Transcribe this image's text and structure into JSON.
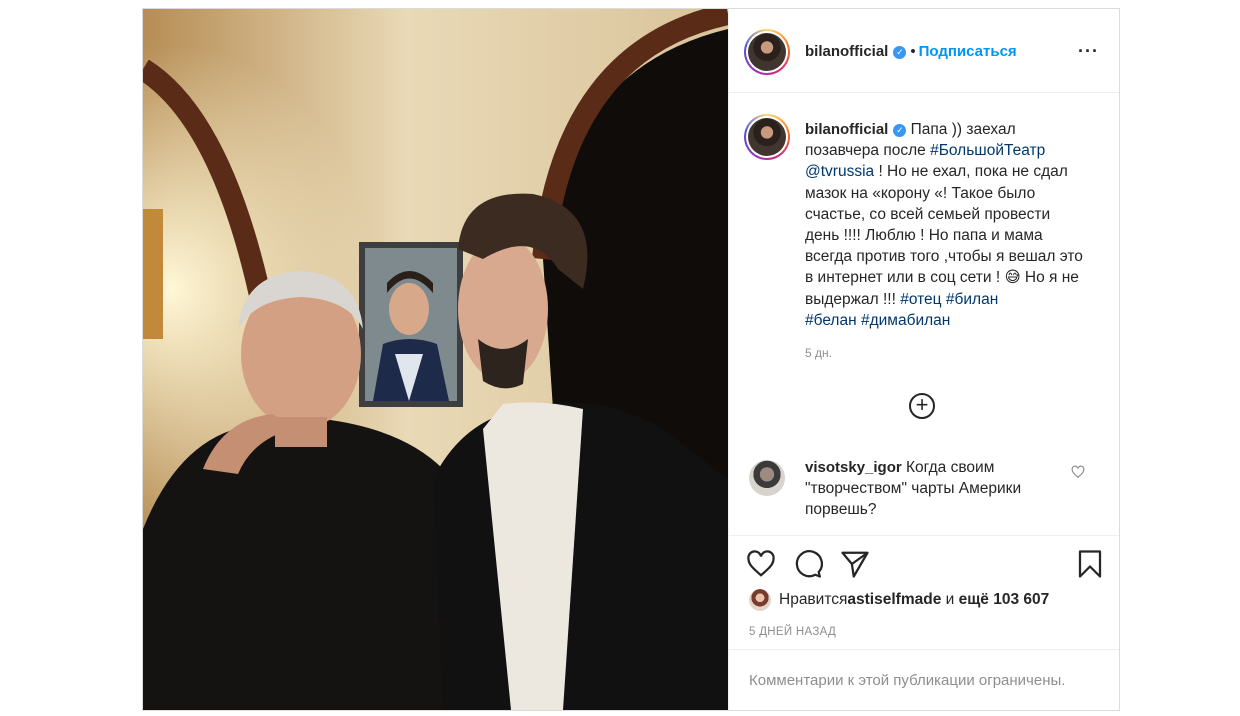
{
  "header": {
    "username": "bilanofficial",
    "separator": "•",
    "follow_label": "Подписаться",
    "more_label": "···"
  },
  "caption": {
    "username": "bilanofficial",
    "text_1": " Папа )) заехал позавчера после ",
    "tag_1": "#БольшойТеатр",
    "text_2": " ",
    "tag_2": "@tvrussia",
    "text_3": " ! Но не ехал, пока не сдал мазок на «корону «! Такое было счастье, со всей семьей провести день !!!! Люблю ! Но папа и мама всегда против того ,чтобы я вешал это в интернет или в соц сети ! 😅 Но я не выдержал !!! ",
    "tag_3": "#отец",
    "text_4": " ",
    "tag_4": "#билан",
    "text_5": " ",
    "tag_5": "#белан",
    "text_6": " ",
    "tag_6": "#димабилан",
    "time": "5 дн."
  },
  "load_more_label": "+",
  "comment": {
    "username": "visotsky_igor",
    "text": " Когда своим \"творчеством\" чарты Америки порвешь?"
  },
  "likes": {
    "prefix": "Нравится ",
    "user": "astiselfmade",
    "middle": " и ",
    "count": "ещё 103 607"
  },
  "date": "5 ДНЕЙ НАЗАД",
  "footer": "Комментарии к этой публикации ограничены.",
  "icons": [
    "heart-icon",
    "comment-icon",
    "share-icon",
    "bookmark-icon",
    "verified-icon",
    "plus-circle-icon"
  ],
  "colors": {
    "link": "#00376b",
    "follow": "#0095f6",
    "verified": "#3897f0",
    "muted": "#8e8e8e"
  }
}
